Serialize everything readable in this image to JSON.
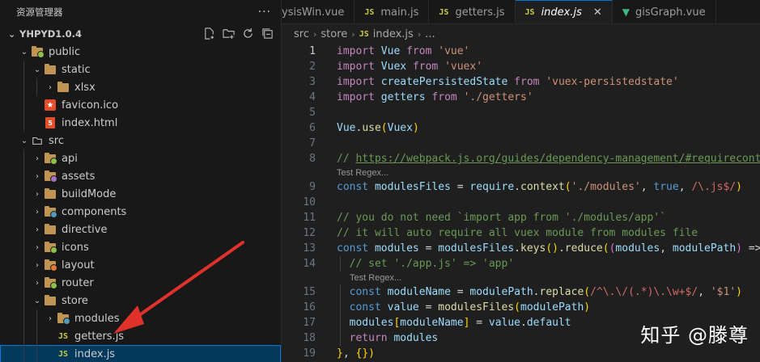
{
  "sidebar": {
    "title": "资源管理器",
    "more": "···",
    "project": "YHPYD1.0.4",
    "tree": [
      {
        "label": "public",
        "depth": 1,
        "kind": "folder",
        "open": true,
        "badge": "#8dc149"
      },
      {
        "label": "static",
        "depth": 2,
        "kind": "folder",
        "open": true,
        "badge": ""
      },
      {
        "label": "xlsx",
        "depth": 3,
        "kind": "folder",
        "open": false,
        "badge": ""
      },
      {
        "label": "favicon.ico",
        "depth": 2,
        "kind": "favicon"
      },
      {
        "label": "index.html",
        "depth": 2,
        "kind": "html"
      },
      {
        "label": "src",
        "depth": 1,
        "kind": "folder-plain",
        "open": true
      },
      {
        "label": "api",
        "depth": 2,
        "kind": "folder",
        "open": false,
        "badge": "#8dc149"
      },
      {
        "label": "assets",
        "depth": 2,
        "kind": "folder",
        "open": false,
        "badge": "#a074c4"
      },
      {
        "label": "buildMode",
        "depth": 2,
        "kind": "folder",
        "open": false,
        "badge": ""
      },
      {
        "label": "components",
        "depth": 2,
        "kind": "folder",
        "open": false,
        "badge": "#519aba"
      },
      {
        "label": "directive",
        "depth": 2,
        "kind": "folder",
        "open": false,
        "badge": ""
      },
      {
        "label": "icons",
        "depth": 2,
        "kind": "folder",
        "open": false,
        "badge": "#8dc149"
      },
      {
        "label": "layout",
        "depth": 2,
        "kind": "folder",
        "open": false,
        "badge": "#e37933"
      },
      {
        "label": "router",
        "depth": 2,
        "kind": "folder",
        "open": false,
        "badge": "#8dc149"
      },
      {
        "label": "store",
        "depth": 2,
        "kind": "folder",
        "open": true,
        "badge": ""
      },
      {
        "label": "modules",
        "depth": 3,
        "kind": "folder",
        "open": false,
        "badge": "#519aba"
      },
      {
        "label": "getters.js",
        "depth": 3,
        "kind": "js"
      },
      {
        "label": "index.js",
        "depth": 3,
        "kind": "js",
        "selected": true
      }
    ]
  },
  "tabs": [
    {
      "label": "ysisWin.vue",
      "kind": "vue",
      "active": false
    },
    {
      "label": "main.js",
      "kind": "js",
      "active": false
    },
    {
      "label": "getters.js",
      "kind": "js",
      "active": false
    },
    {
      "label": "index.js",
      "kind": "js",
      "active": true
    },
    {
      "label": "gisGraph.vue",
      "kind": "vue",
      "active": false
    }
  ],
  "breadcrumb": [
    "src",
    "store",
    "index.js",
    "..."
  ],
  "code": {
    "lines": [
      "import Vue from 'vue'",
      "import Vuex from 'vuex'",
      "import createPersistedState from 'vuex-persistedstate'",
      "import getters from './getters'",
      "",
      "Vue.use(Vuex)",
      "",
      "// https://webpack.js.org/guides/dependency-management/#requirecontext",
      "const modulesFiles = require.context('./modules', true, /\\.js$/)",
      "",
      "// you do not need `import app from './modules/app'`",
      "// it will auto require all vuex module from modules file",
      "const modules = modulesFiles.keys().reduce((modules, modulePath) => {",
      "  // set './app.js' => 'app'",
      "  const moduleName = modulePath.replace(/^\\.\\/(.*)\\.\\w+$/, '$1')",
      "  const value = modulesFiles(modulePath)",
      "  modules[moduleName] = value.default",
      "  return modules",
      "}, {})"
    ],
    "codelens": "Test Regex..."
  },
  "watermark": "知乎 @滕尊",
  "colors": {
    "keyword": "#c586c0",
    "storage": "#569cd6",
    "variable": "#9cdcfe",
    "string": "#ce9178",
    "function": "#dcdcaa",
    "comment": "#6a9955",
    "regex": "#d16969",
    "selection": "#04395e",
    "accent": "#0078d4",
    "arrow": "#e0312b"
  }
}
